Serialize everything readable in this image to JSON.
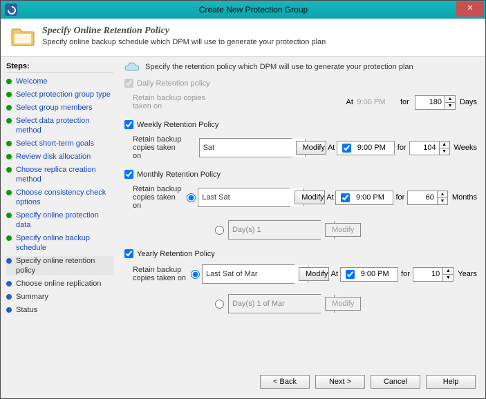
{
  "window": {
    "title": "Create New Protection Group",
    "close": "✕"
  },
  "header": {
    "title": "Specify Online Retention Policy",
    "subtitle": "Specify online backup schedule which DPM will use to generate your protection plan"
  },
  "sidebar": {
    "heading": "Steps:",
    "items": [
      {
        "label": "Welcome",
        "state": "done"
      },
      {
        "label": "Select protection group type",
        "state": "done"
      },
      {
        "label": "Select group members",
        "state": "done"
      },
      {
        "label": "Select data protection method",
        "state": "done"
      },
      {
        "label": "Select short-term goals",
        "state": "done"
      },
      {
        "label": "Review disk allocation",
        "state": "done"
      },
      {
        "label": "Choose replica creation method",
        "state": "done"
      },
      {
        "label": "Choose consistency check options",
        "state": "done"
      },
      {
        "label": "Specify online protection data",
        "state": "done"
      },
      {
        "label": "Specify online backup schedule",
        "state": "done"
      },
      {
        "label": "Specify online retention policy",
        "state": "current"
      },
      {
        "label": "Choose online replication",
        "state": "pending"
      },
      {
        "label": "Summary",
        "state": "pending"
      },
      {
        "label": "Status",
        "state": "pending"
      }
    ]
  },
  "content": {
    "intro": "Specify the retention policy which DPM will use to generate your protection plan",
    "labels": {
      "retain": "Retain backup copies taken on",
      "at": "At",
      "for": "for",
      "modify": "Modify"
    },
    "daily": {
      "title": "Daily Retention policy",
      "checked": true,
      "enabled": false,
      "time": "9:00 PM",
      "value": "180",
      "unit": "Days"
    },
    "weekly": {
      "title": "Weekly Retention Policy",
      "checked": true,
      "schedule": "Sat",
      "time": "9:00 PM",
      "timeChecked": true,
      "value": "104",
      "unit": "Weeks"
    },
    "monthly": {
      "title": "Monthly Retention Policy",
      "checked": true,
      "opt1": "Last Sat",
      "opt2": "Day(s) 1",
      "selected": 1,
      "time": "9:00 PM",
      "timeChecked": true,
      "value": "60",
      "unit": "Months"
    },
    "yearly": {
      "title": "Yearly Retention Policy",
      "checked": true,
      "opt1": "Last Sat of Mar",
      "opt2": "Day(s) 1 of Mar",
      "selected": 1,
      "time": "9:00 PM",
      "timeChecked": true,
      "value": "10",
      "unit": "Years"
    }
  },
  "footer": {
    "back": "< Back",
    "next": "Next >",
    "cancel": "Cancel",
    "help": "Help"
  }
}
